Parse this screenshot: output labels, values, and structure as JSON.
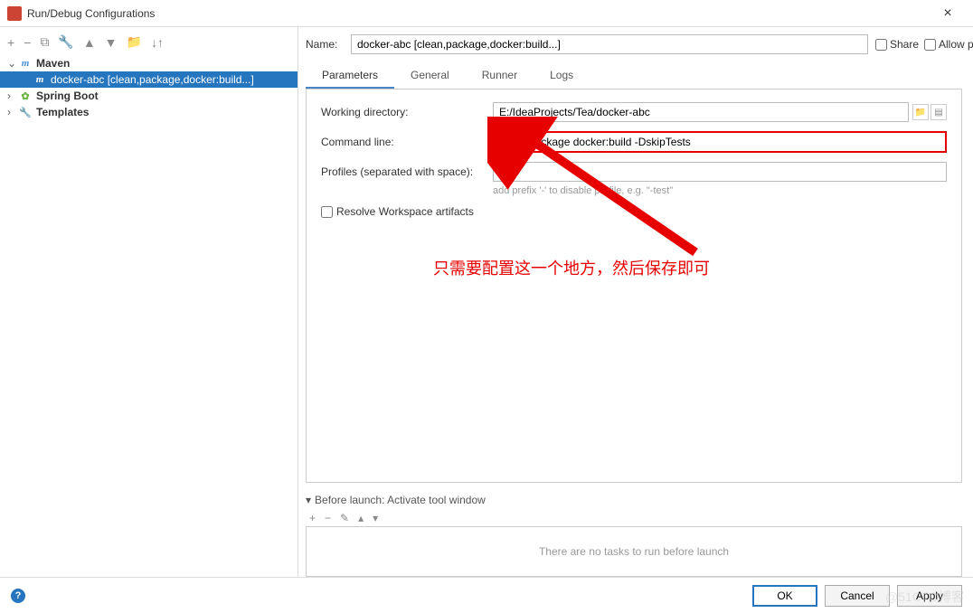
{
  "window": {
    "title": "Run/Debug Configurations"
  },
  "toolbar_icons": {
    "add": "+",
    "remove": "−",
    "copy": "⧉",
    "wrench": "🔧",
    "up": "▲",
    "down": "▼",
    "folder": "📁",
    "sort": "↓↑"
  },
  "tree": {
    "maven": {
      "label": "Maven",
      "child": "docker-abc [clean,package,docker:build...]"
    },
    "spring": {
      "label": "Spring Boot"
    },
    "templates": {
      "label": "Templates"
    }
  },
  "name": {
    "label": "Name:",
    "value": "docker-abc [clean,package,docker:build...]"
  },
  "options": {
    "share": "Share",
    "parallel": "Allow parallel run"
  },
  "tabs": {
    "parameters": "Parameters",
    "general": "General",
    "runner": "Runner",
    "logs": "Logs"
  },
  "form": {
    "workdir": {
      "label": "Working directory:",
      "value": "E:/IdeaProjects/Tea/docker-abc"
    },
    "cmdline": {
      "label": "Command line:",
      "value": "clean package docker:build -DskipTests"
    },
    "profiles": {
      "label": "Profiles (separated with space):",
      "value": "",
      "hint": "add prefix '-' to disable profile, e.g. \"-test\""
    },
    "resolve": "Resolve Workspace artifacts"
  },
  "annotation": "只需要配置这一个地方，然后保存即可",
  "before_launch": {
    "title": "Before launch: Activate tool window",
    "empty": "There are no tasks to run before launch"
  },
  "buttons": {
    "ok": "OK",
    "cancel": "Cancel",
    "apply": "Apply"
  },
  "watermark": "@51CTO博客"
}
